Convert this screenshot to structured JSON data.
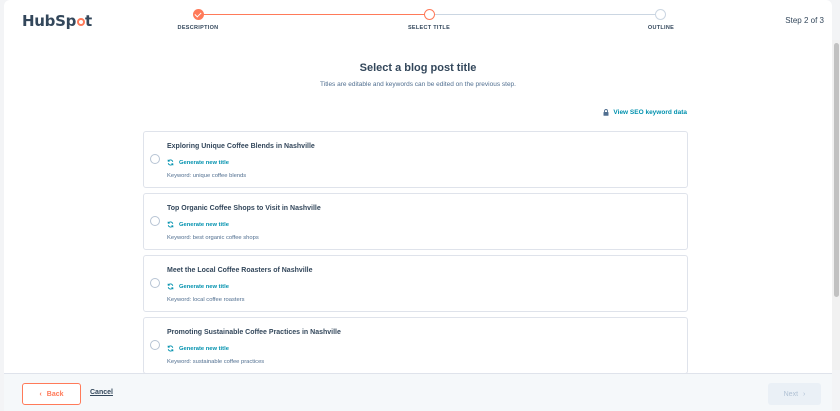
{
  "header": {
    "logo_text_a": "Hub",
    "logo_text_b": "Sp",
    "logo_text_c": "t",
    "step_count": "Step 2 of 3",
    "steps": [
      {
        "label": "DESCRIPTION",
        "state": "complete"
      },
      {
        "label": "SELECT TITLE",
        "state": "current"
      },
      {
        "label": "OUTLINE",
        "state": "pending"
      }
    ]
  },
  "main": {
    "title": "Select a blog post title",
    "subtitle": "Titles are editable and keywords can be edited on the previous step.",
    "seo_link": "View SEO keyword data",
    "cards": [
      {
        "title": "Exploring Unique Coffee Blends in Nashville",
        "generate": "Generate new title",
        "keyword": "Keyword: unique coffee blends"
      },
      {
        "title": "Top Organic Coffee Shops to Visit in Nashville",
        "generate": "Generate new title",
        "keyword": "Keyword: best organic coffee shops"
      },
      {
        "title": "Meet the Local Coffee Roasters of Nashville",
        "generate": "Generate new title",
        "keyword": "Keyword: local coffee roasters"
      },
      {
        "title": "Promoting Sustainable Coffee Practices in Nashville",
        "generate": "Generate new title",
        "keyword": "Keyword: sustainable coffee practices"
      }
    ]
  },
  "footer": {
    "back_label": "Back",
    "cancel_label": "Cancel",
    "next_label": "Next"
  },
  "colors": {
    "accent": "#ff7a59",
    "link": "#0091ae",
    "text": "#33475b"
  }
}
